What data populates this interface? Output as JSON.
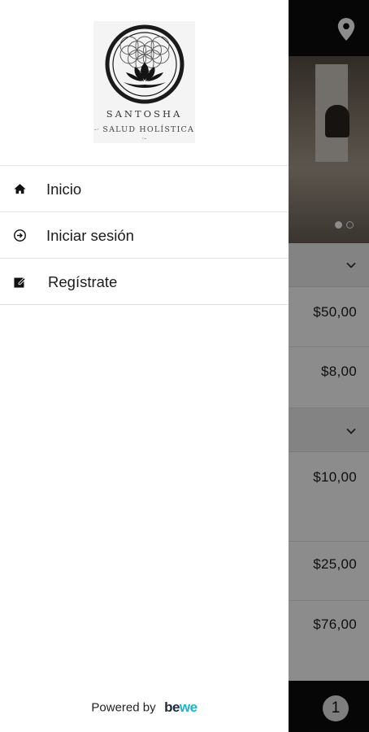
{
  "background": {
    "prices": [
      "$50,00",
      "$8,00",
      "$10,00",
      "$25,00",
      "$76,00"
    ],
    "cart_count": "1",
    "icons": {
      "location": "map-pin-icon",
      "chevron": "chevron-down-icon"
    }
  },
  "drawer": {
    "logo": {
      "name": "SANTOSHA",
      "subtitle": "SALUD HOLÍSTICA"
    },
    "menu": [
      {
        "label": "Inicio",
        "icon": "home-icon"
      },
      {
        "label": "Iniciar sesión",
        "icon": "login-icon"
      },
      {
        "label": "Regístrate",
        "icon": "register-icon"
      }
    ],
    "footer": {
      "powered_by": "Powered by",
      "brand_prefix": "be",
      "brand_accent": "we"
    }
  },
  "colors": {
    "topbar": "#0c0c0c",
    "scrim": "rgba(0,0,0,0.45)",
    "brand_accent": "#1fb3c9"
  }
}
